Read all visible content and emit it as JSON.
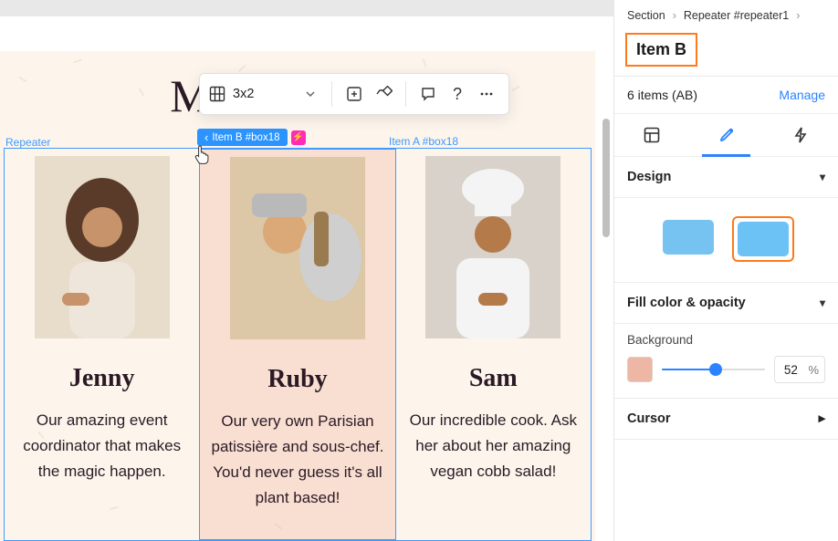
{
  "canvas": {
    "page_title": "Meet the team",
    "repeater_label": "Repeater",
    "item_b_chip": "Item B #box18",
    "item_a_chip": "Item A #box18",
    "cards": [
      {
        "name": "Jenny",
        "desc": "Our amazing event coordinator that makes the magic happen."
      },
      {
        "name": "Ruby",
        "desc": "Our very own Parisian patissière and sous-chef. You'd never guess it's all plant based!"
      },
      {
        "name": "Sam",
        "desc": "Our incredible cook. Ask her about her amazing vegan cobb salad!"
      }
    ]
  },
  "toolbar": {
    "grid_label": "3x2"
  },
  "panel": {
    "breadcrumb": {
      "a": "Section",
      "b": "Repeater #repeater1"
    },
    "title": "Item B",
    "items_summary": "6 items (AB)",
    "manage": "Manage",
    "design_hdr": "Design",
    "fill_hdr": "Fill color & opacity",
    "background_lbl": "Background",
    "opacity_value": "52",
    "opacity_unit": "%",
    "cursor_hdr": "Cursor",
    "colors": {
      "swatch1": "#76c3f2",
      "swatch2": "#6cc2f4",
      "bg_sample": "#eeb6a4",
      "accent": "#2b83ff"
    }
  }
}
